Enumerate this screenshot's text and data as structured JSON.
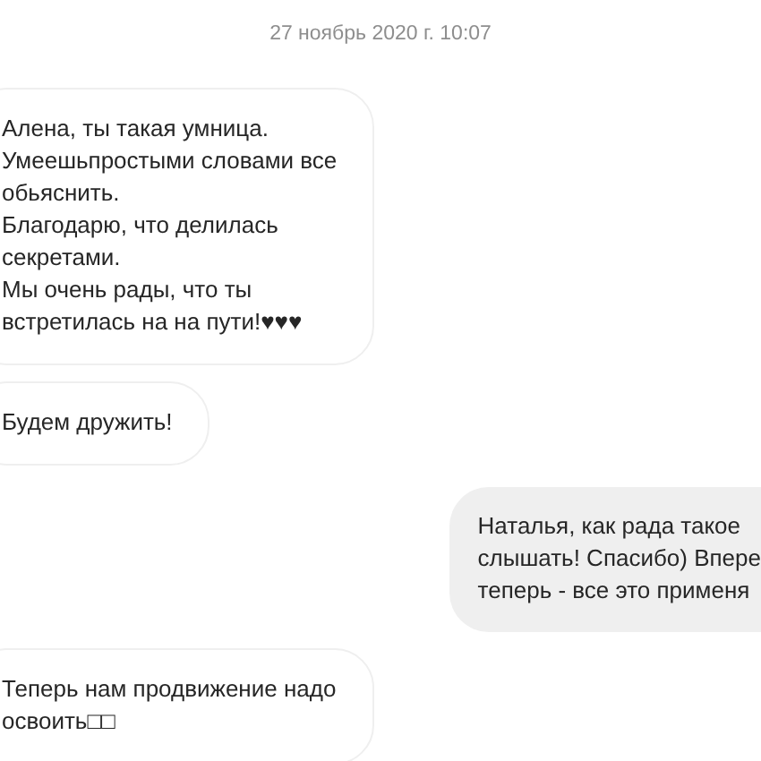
{
  "timestamp": "27 ноябрь 2020 г. 10:07",
  "messages": [
    {
      "kind": "incoming",
      "lines": [
        "Алена, ты такая умница.",
        "Умеешьпростыми словами все",
        "обьяснить.",
        "Благодарю, что делилась",
        "секретами.",
        "Мы очень рады, что ты",
        "встретилась на на пути!♥♥♥"
      ]
    },
    {
      "kind": "incoming",
      "lines": [
        "Будем дружить!"
      ]
    },
    {
      "kind": "outgoing",
      "lines": [
        "Наталья, как рада такое",
        "слышать! Спасибо) Впере",
        "теперь - все это применя"
      ]
    },
    {
      "kind": "incoming",
      "lines": [
        "Теперь нам продвижение надо",
        "освоить□□"
      ]
    }
  ]
}
